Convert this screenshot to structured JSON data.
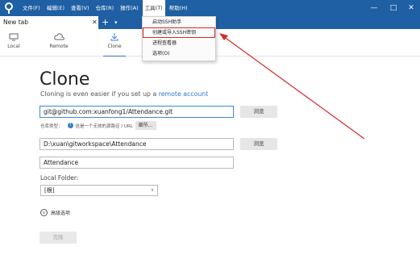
{
  "menu": {
    "items": [
      "文件(F)",
      "编辑(E)",
      "查看(V)",
      "仓库(R)",
      "操作(A)",
      "工具(T)",
      "帮助(H)"
    ],
    "active_index": 5
  },
  "window_controls": {
    "minimize": "—",
    "maximize": "□",
    "close": "✕"
  },
  "tabs": {
    "current": "New tab",
    "close": "✕",
    "add": "+",
    "dropdown": "▾"
  },
  "toolbar": {
    "local": "Local",
    "remote": "Remote",
    "clone": "Clone"
  },
  "tools_menu": {
    "items": [
      "启动SSH助手",
      "创建或导入SSH密钥",
      "进程查看器",
      "选项(O)"
    ],
    "highlighted_index": 1
  },
  "clone": {
    "heading": "Clone",
    "subtitle_prefix": "Cloning is even easier if you set up a ",
    "subtitle_link": "remote account",
    "source_url": "git@github.com:xuanfong1/Attendance.git",
    "browse_label": "浏览",
    "repo_type_label": "仓库类型：",
    "repo_type_hint": "这是一个无效的源路径 / URL",
    "details_label": "细节...",
    "destination_path": "D:\\xuan\\gitworkspace\\Attendance",
    "name": "Attendance",
    "local_folder_label": "Local Folder:",
    "local_folder_value": "[根]",
    "advanced_label": "高级选项",
    "clone_button": "克隆"
  },
  "colors": {
    "titlebar": "#1f5fa3",
    "accent": "#2a78c8",
    "annotation": "#d62a2a"
  }
}
